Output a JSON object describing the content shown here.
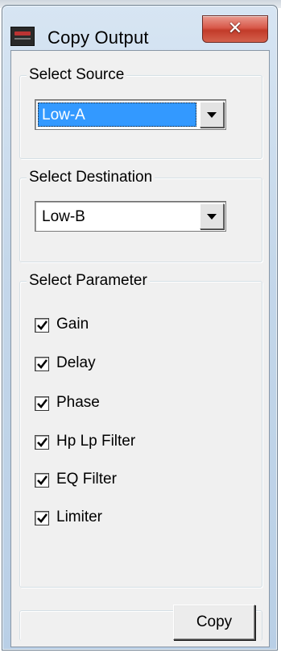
{
  "window": {
    "title": "Copy Output",
    "close_glyph": "✕"
  },
  "source": {
    "legend": "Select Source",
    "value": "Low-A"
  },
  "destination": {
    "legend": "Select Destination",
    "value": "Low-B"
  },
  "parameters": {
    "legend": "Select Parameter",
    "items": [
      {
        "label": "Gain",
        "checked": true
      },
      {
        "label": "Delay",
        "checked": true
      },
      {
        "label": "Phase",
        "checked": true
      },
      {
        "label": "Hp Lp Filter",
        "checked": true
      },
      {
        "label": "EQ Filter",
        "checked": true
      },
      {
        "label": "Limiter",
        "checked": true
      }
    ]
  },
  "actions": {
    "copy_label": "Copy"
  },
  "colors": {
    "selection_highlight": "#3399ff",
    "close_button": "#c23b29",
    "dialog_background": "#f0f0f0"
  }
}
